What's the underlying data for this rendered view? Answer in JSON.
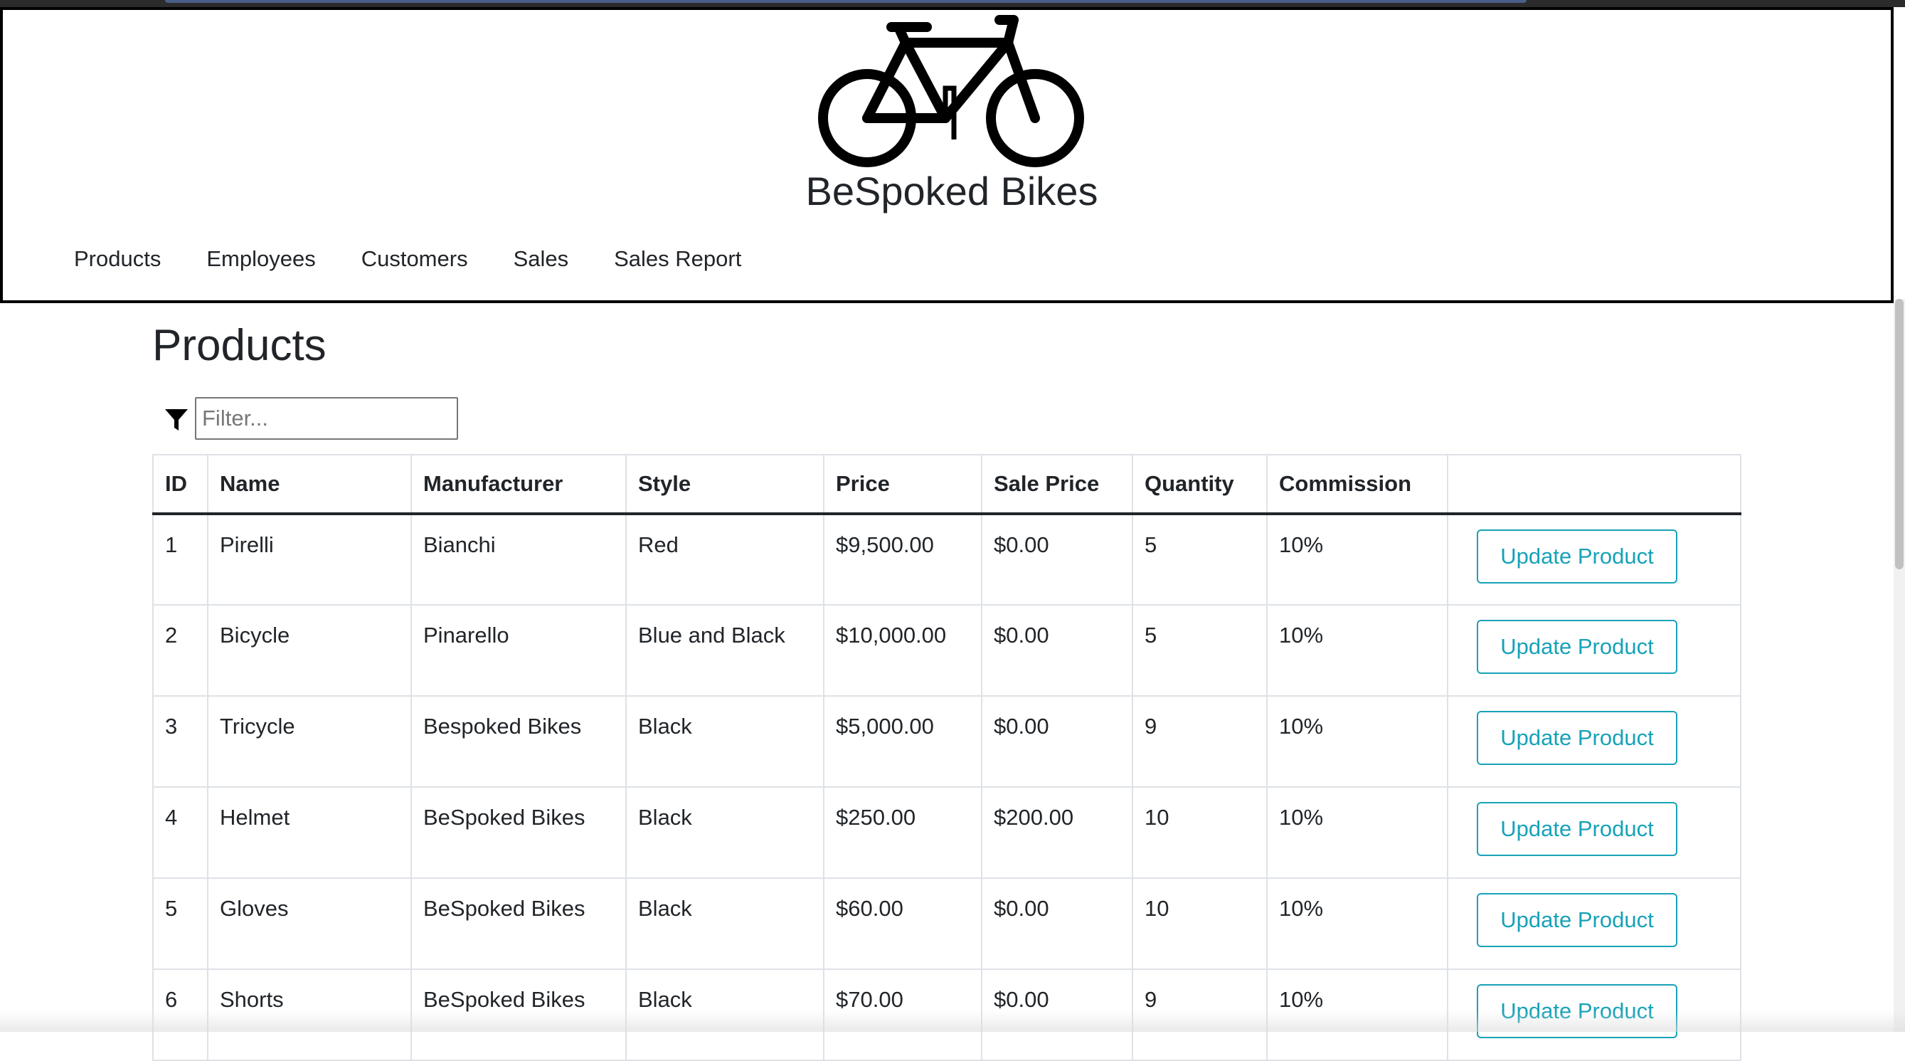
{
  "header": {
    "brand": "BeSpoked Bikes",
    "logo_icon": "bicycle-icon"
  },
  "nav": {
    "items": [
      {
        "label": "Products"
      },
      {
        "label": "Employees"
      },
      {
        "label": "Customers"
      },
      {
        "label": "Sales"
      },
      {
        "label": "Sales Report"
      }
    ]
  },
  "main": {
    "title": "Products",
    "filter": {
      "icon": "filter-icon",
      "placeholder": "Filter...",
      "value": ""
    },
    "table": {
      "columns": [
        "ID",
        "Name",
        "Manufacturer",
        "Style",
        "Price",
        "Sale Price",
        "Quantity",
        "Commission",
        ""
      ],
      "rows": [
        {
          "id": "1",
          "name": "Pirelli",
          "manufacturer": "Bianchi",
          "style": "Red",
          "price": "$9,500.00",
          "sale_price": "$0.00",
          "quantity": "5",
          "commission": "10%",
          "action": "Update Product"
        },
        {
          "id": "2",
          "name": "Bicycle",
          "manufacturer": "Pinarello",
          "style": "Blue and Black",
          "price": "$10,000.00",
          "sale_price": "$0.00",
          "quantity": "5",
          "commission": "10%",
          "action": "Update Product"
        },
        {
          "id": "3",
          "name": "Tricycle",
          "manufacturer": "Bespoked Bikes",
          "style": "Black",
          "price": "$5,000.00",
          "sale_price": "$0.00",
          "quantity": "9",
          "commission": "10%",
          "action": "Update Product"
        },
        {
          "id": "4",
          "name": "Helmet",
          "manufacturer": "BeSpoked Bikes",
          "style": "Black",
          "price": "$250.00",
          "sale_price": "$200.00",
          "quantity": "10",
          "commission": "10%",
          "action": "Update Product"
        },
        {
          "id": "5",
          "name": "Gloves",
          "manufacturer": "BeSpoked Bikes",
          "style": "Black",
          "price": "$60.00",
          "sale_price": "$0.00",
          "quantity": "10",
          "commission": "10%",
          "action": "Update Product"
        },
        {
          "id": "6",
          "name": "Shorts",
          "manufacturer": "BeSpoked Bikes",
          "style": "Black",
          "price": "$70.00",
          "sale_price": "$0.00",
          "quantity": "9",
          "commission": "10%",
          "action": "Update Product"
        }
      ]
    }
  },
  "colors": {
    "accent": "#17a2b8",
    "text": "#212529",
    "border": "#dee2e6"
  }
}
